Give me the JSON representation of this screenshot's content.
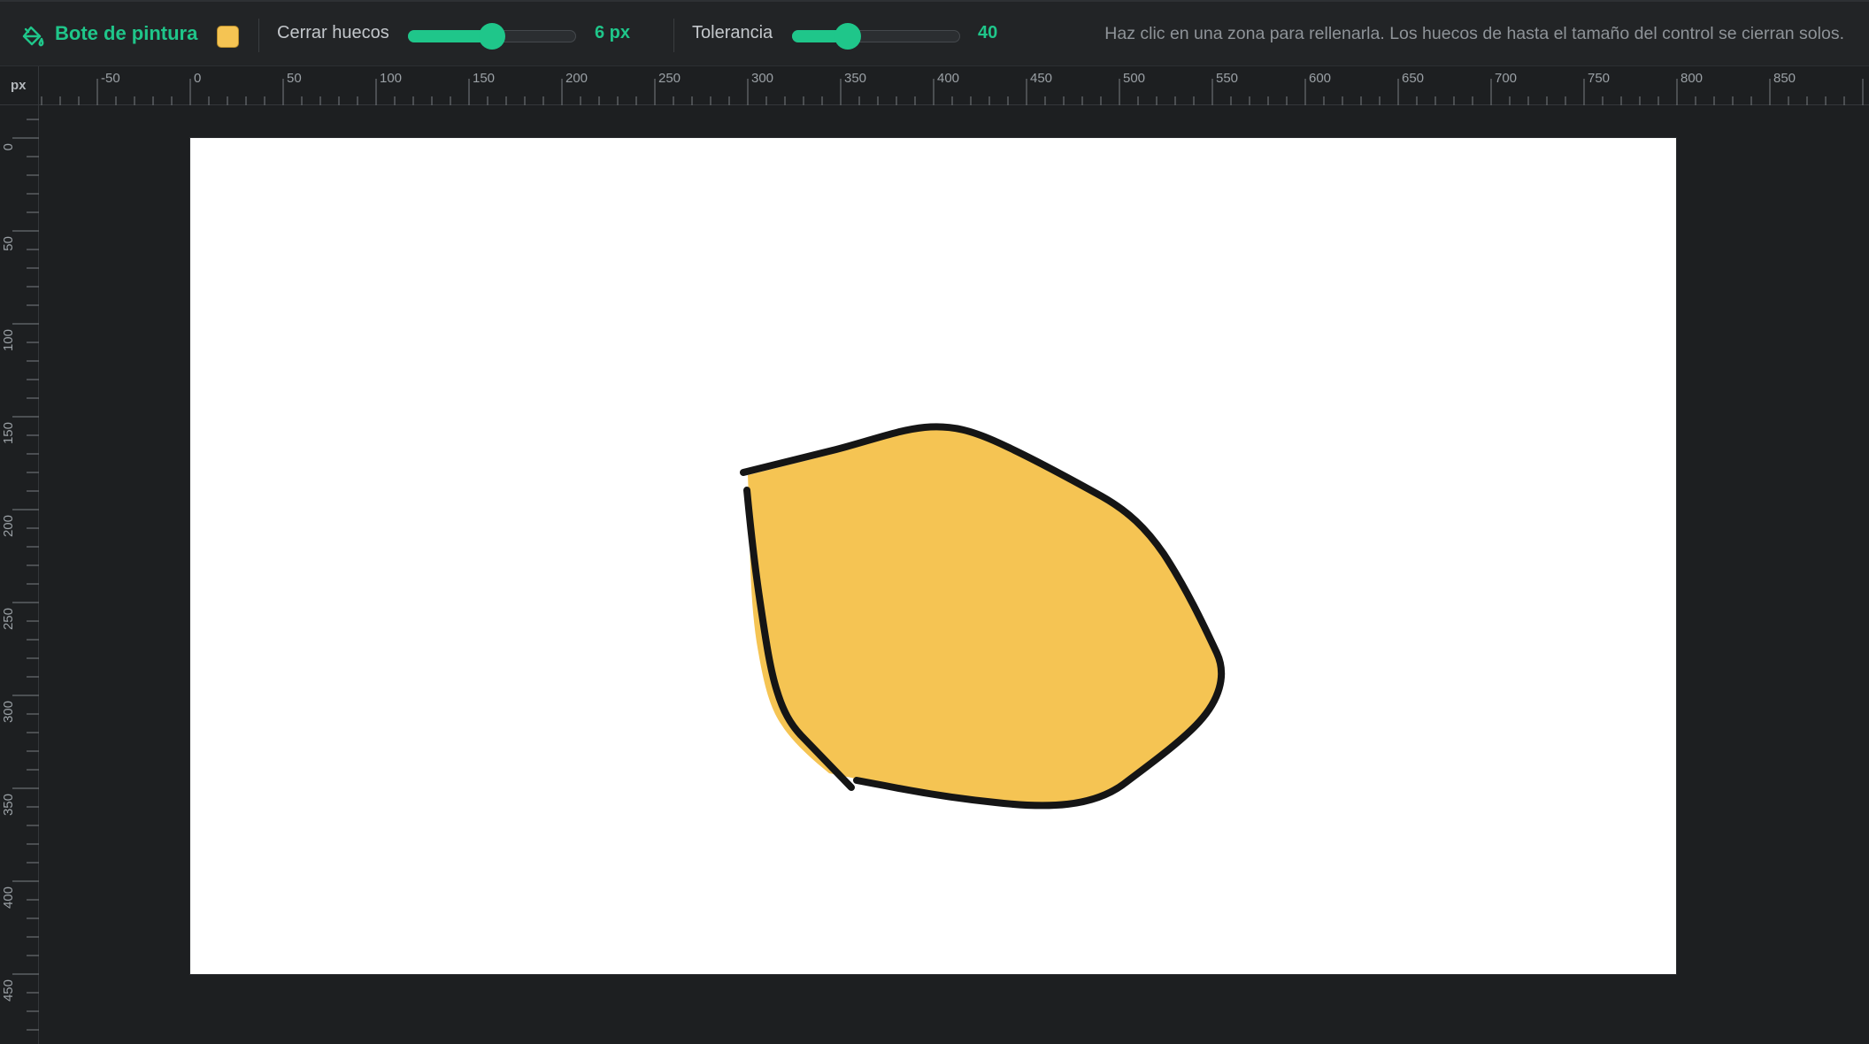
{
  "toolbar": {
    "tool_name": "Bote de pintura",
    "tool_icon": "paint-bucket-icon",
    "fill_color": "#f5c453",
    "gap_close": {
      "label": "Cerrar huecos",
      "value": 0.5,
      "value_text": "6 px"
    },
    "tolerance": {
      "label": "Tolerancia",
      "value": 0.33,
      "value_text": "40"
    },
    "hint": "Haz clic en una zona para rellenarla. Los huecos de hasta el tamaño del control se cierran solos."
  },
  "rulers": {
    "unit": "px",
    "horizontal_labels": [
      "-50",
      "0",
      "50",
      "100",
      "150",
      "200",
      "250",
      "300",
      "350",
      "400",
      "450",
      "500",
      "550",
      "600",
      "650",
      "700",
      "750",
      "800",
      "850"
    ],
    "vertical_labels": [
      "0",
      "50",
      "100",
      "150",
      "200",
      "250",
      "300",
      "350",
      "400",
      "450"
    ]
  },
  "colors": {
    "accent": "#1fc68a",
    "stroke": "#151515",
    "fill": "#f5c453"
  }
}
